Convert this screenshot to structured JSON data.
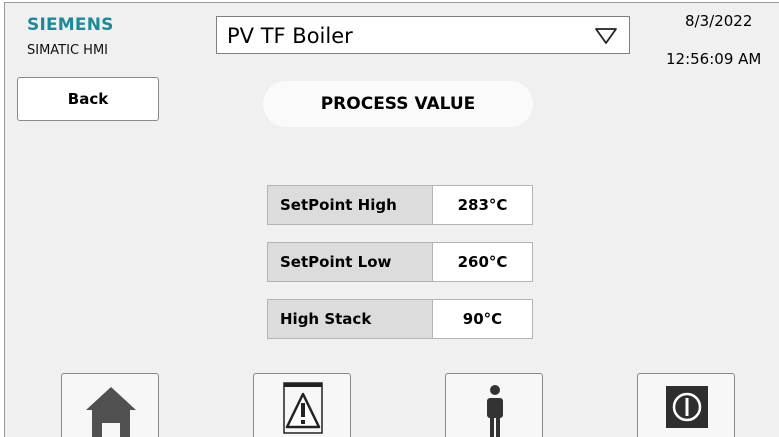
{
  "header": {
    "brand": "SIEMENS",
    "sub_brand": "SIMATIC HMI",
    "date": "8/3/2022",
    "time": "12:56:09 AM"
  },
  "dropdown": {
    "selected": "PV TF Boiler",
    "icon": "chevron-down-icon"
  },
  "back_button": {
    "label": "Back"
  },
  "screen_title": "PROCESS VALUE",
  "process_values": [
    {
      "label": "SetPoint High",
      "value": "283°C"
    },
    {
      "label": "SetPoint Low",
      "value": "260°C"
    },
    {
      "label": "High Stack",
      "value": "90°C"
    }
  ],
  "nav_buttons": [
    {
      "icon": "home-icon"
    },
    {
      "icon": "alarm-warning-icon"
    },
    {
      "icon": "user-icon"
    },
    {
      "icon": "power-icon"
    }
  ],
  "colors": {
    "brand": "#1c8a9a",
    "background": "#f0f0f0",
    "label_cell": "#dcdcdc",
    "icon": "#505050"
  }
}
